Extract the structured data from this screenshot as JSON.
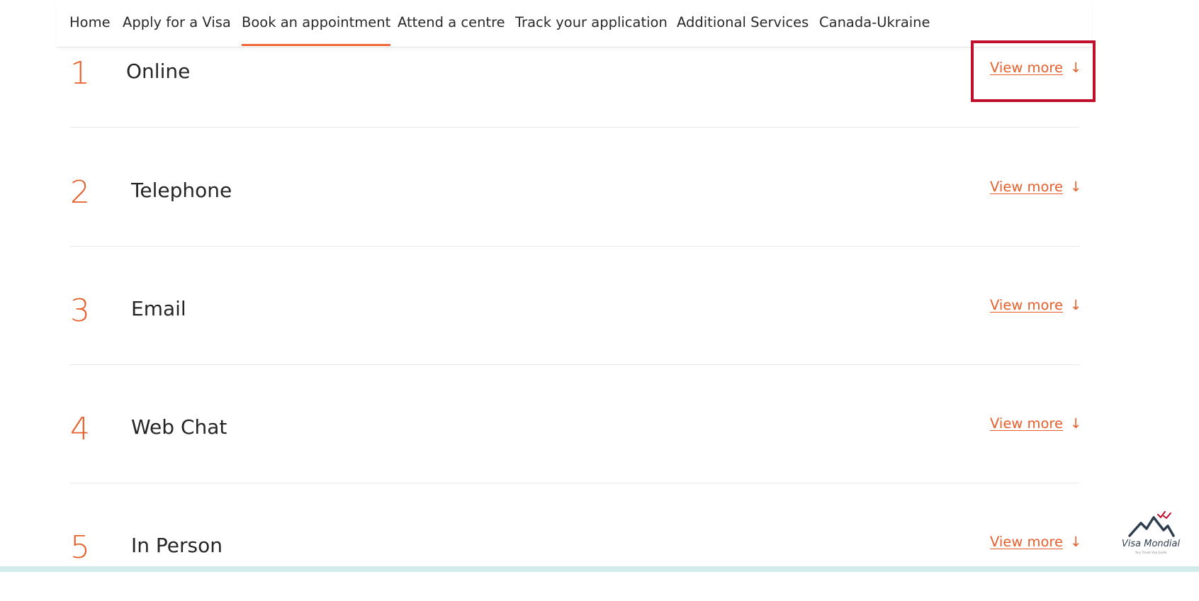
{
  "nav": {
    "items": [
      {
        "label": "Home",
        "active": false
      },
      {
        "label": "Apply for a Visa",
        "active": false
      },
      {
        "label": "Book an appointment",
        "active": true
      },
      {
        "label": "Attend a centre",
        "active": false
      },
      {
        "label": "Track your application",
        "active": false
      },
      {
        "label": "Additional Services",
        "active": false
      },
      {
        "label": "Canada-Ukraine",
        "active": false
      }
    ]
  },
  "methods": [
    {
      "number": "1",
      "title": "Online",
      "link": "View more",
      "arrow": "↓"
    },
    {
      "number": "2",
      "title": "Telephone",
      "link": "View more",
      "arrow": "↓"
    },
    {
      "number": "3",
      "title": "Email",
      "link": "View more",
      "arrow": "↓"
    },
    {
      "number": "4",
      "title": "Web Chat",
      "link": "View more",
      "arrow": "↓"
    },
    {
      "number": "5",
      "title": "In Person",
      "link": "View more",
      "arrow": "↓"
    }
  ],
  "watermark": {
    "name": "Visa Mondial",
    "tagline": "Your Travel Visa Guide"
  },
  "colors": {
    "accent": "#e85e2a",
    "highlight": "#c0102b",
    "text": "#222222"
  }
}
